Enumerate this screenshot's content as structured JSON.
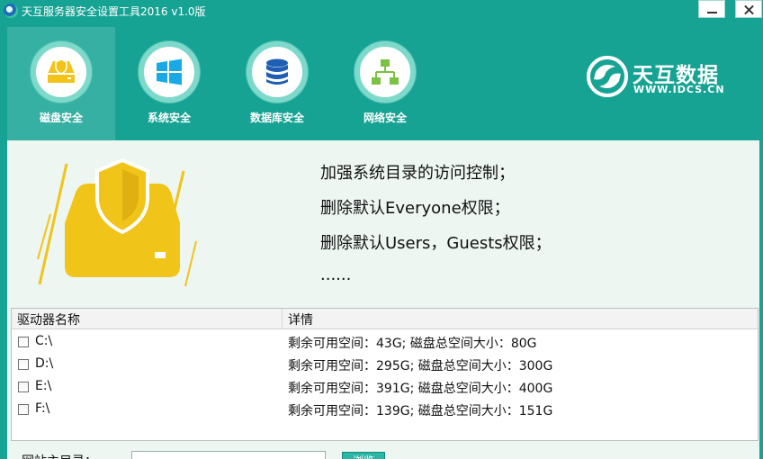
{
  "window": {
    "title": "天互服务器安全设置工具2016 v1.0版"
  },
  "tabs": [
    {
      "label": "磁盘安全",
      "icon": "disk-icon",
      "active": true
    },
    {
      "label": "系统安全",
      "icon": "windows-icon",
      "active": false
    },
    {
      "label": "数据库安全",
      "icon": "database-icon",
      "active": false
    },
    {
      "label": "网络安全",
      "icon": "network-icon",
      "active": false
    }
  ],
  "brand": {
    "name": "天互数据",
    "url": "WWW.IDCS.CN"
  },
  "description": {
    "lines": [
      "加强系统目录的访问控制；",
      "删除默认Everyone权限；",
      "删除默认Users，Guests权限；",
      "......"
    ]
  },
  "drive_table": {
    "columns": [
      "驱动器名称",
      "详情"
    ],
    "rows": [
      {
        "name": "C:\\",
        "detail": "剩余可用空间：43G; 磁盘总空间大小：80G",
        "checked": false
      },
      {
        "name": "D:\\",
        "detail": "剩余可用空间：295G; 磁盘总空间大小：300G",
        "checked": false
      },
      {
        "name": "E:\\",
        "detail": "剩余可用空间：391G; 磁盘总空间大小：400G",
        "checked": false
      },
      {
        "name": "F:\\",
        "detail": "剩余可用空间：139G; 磁盘总空间大小：151G",
        "checked": false
      }
    ]
  },
  "site_root": {
    "label": "网站主目录：",
    "value": "",
    "button_label": "浏览"
  },
  "colors": {
    "header_bg": "#16a394",
    "content_bg": "#edf6f1",
    "accent_yellow": "#f0c419"
  }
}
